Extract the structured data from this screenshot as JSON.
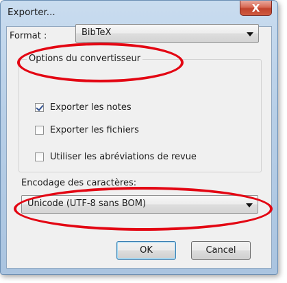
{
  "window": {
    "title": "Exporter...",
    "close_label": "X"
  },
  "format": {
    "label": "Format :",
    "selected": "BibTeX"
  },
  "options_group": {
    "legend": "Options du convertisseur",
    "checkboxes": [
      {
        "label": "Exporter les notes",
        "checked": true
      },
      {
        "label": "Exporter les fichiers",
        "checked": false
      },
      {
        "label": "Utiliser les abréviations de revue",
        "checked": false
      }
    ]
  },
  "encoding": {
    "label": "Encodage des caractères:",
    "selected": "Unicode (UTF-8 sans BOM)"
  },
  "buttons": {
    "ok": "OK",
    "cancel": "Cancel"
  },
  "colors": {
    "highlight": "#e30613",
    "close_button": "#c1432d"
  }
}
